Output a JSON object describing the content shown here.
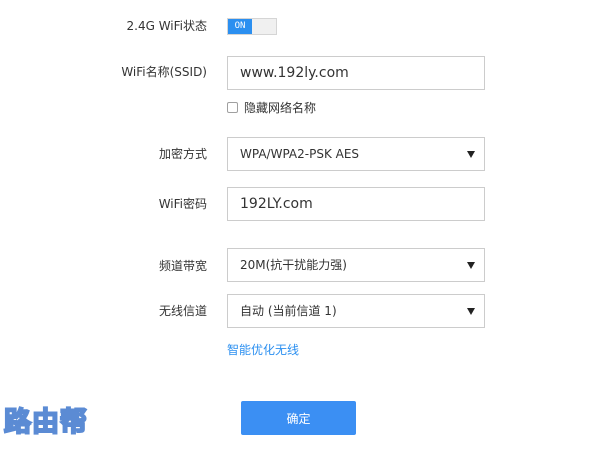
{
  "form": {
    "wifi_status": {
      "label": "2.4G WiFi状态",
      "toggle_text": "ON"
    },
    "ssid": {
      "label": "WiFi名称(SSID)",
      "value": "www.192ly.com"
    },
    "hide_ssid": {
      "label": "隐藏网络名称",
      "checked": false
    },
    "encryption": {
      "label": "加密方式",
      "selected": "WPA/WPA2-PSK AES"
    },
    "password": {
      "label": "WiFi密码",
      "value": "192LY.com"
    },
    "bandwidth": {
      "label": "频道带宽",
      "selected": "20M(抗干扰能力强)"
    },
    "channel": {
      "label": "无线信道",
      "selected": "自动 (当前信道 1)"
    },
    "optimize_link": "智能优化无线",
    "submit_label": "确定"
  },
  "watermark": "路由帮",
  "colors": {
    "accent": "#2b8ff0",
    "button": "#3b8ff3",
    "watermark_stroke": "#4a7fd0"
  }
}
